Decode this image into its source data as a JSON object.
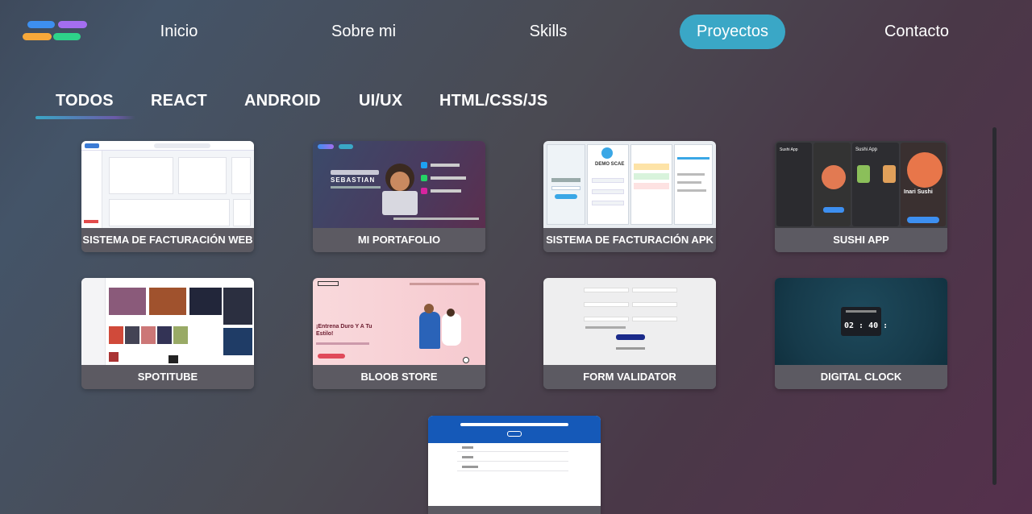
{
  "nav": {
    "links": [
      {
        "label": "Inicio",
        "active": false
      },
      {
        "label": "Sobre mi",
        "active": false
      },
      {
        "label": "Skills",
        "active": false
      },
      {
        "label": "Proyectos",
        "active": true
      },
      {
        "label": "Contacto",
        "active": false
      }
    ]
  },
  "filters": {
    "tabs": [
      "TODOS",
      "REACT",
      "ANDROID",
      "UI/UX",
      "HTML/CSS/JS"
    ],
    "selected": "TODOS"
  },
  "projects": [
    {
      "title": "SISTEMA DE FACTURACIÓN WEB"
    },
    {
      "title": "MI PORTAFOLIO",
      "thumb_heading": "SEBASTIAN"
    },
    {
      "title": "SISTEMA DE FACTURACIÓN APK",
      "thumb_heading": "DEMO SCAE"
    },
    {
      "title": "SUSHI APP",
      "thumb_heading": "Sushi App",
      "thumb_sub": "Inari Sushi"
    },
    {
      "title": "SPOTITUBE"
    },
    {
      "title": "BLOOB STORE",
      "thumb_heading": "¡Entrena Duro Y A Tu Estilo!"
    },
    {
      "title": "FORM VALIDATOR"
    },
    {
      "title": "DIGITAL CLOCK",
      "thumb_time": "02 : 40 :"
    },
    {
      "title": ""
    }
  ],
  "colors": {
    "accent": "#3aa7c6",
    "card_label_bg": "#5c5a62"
  }
}
